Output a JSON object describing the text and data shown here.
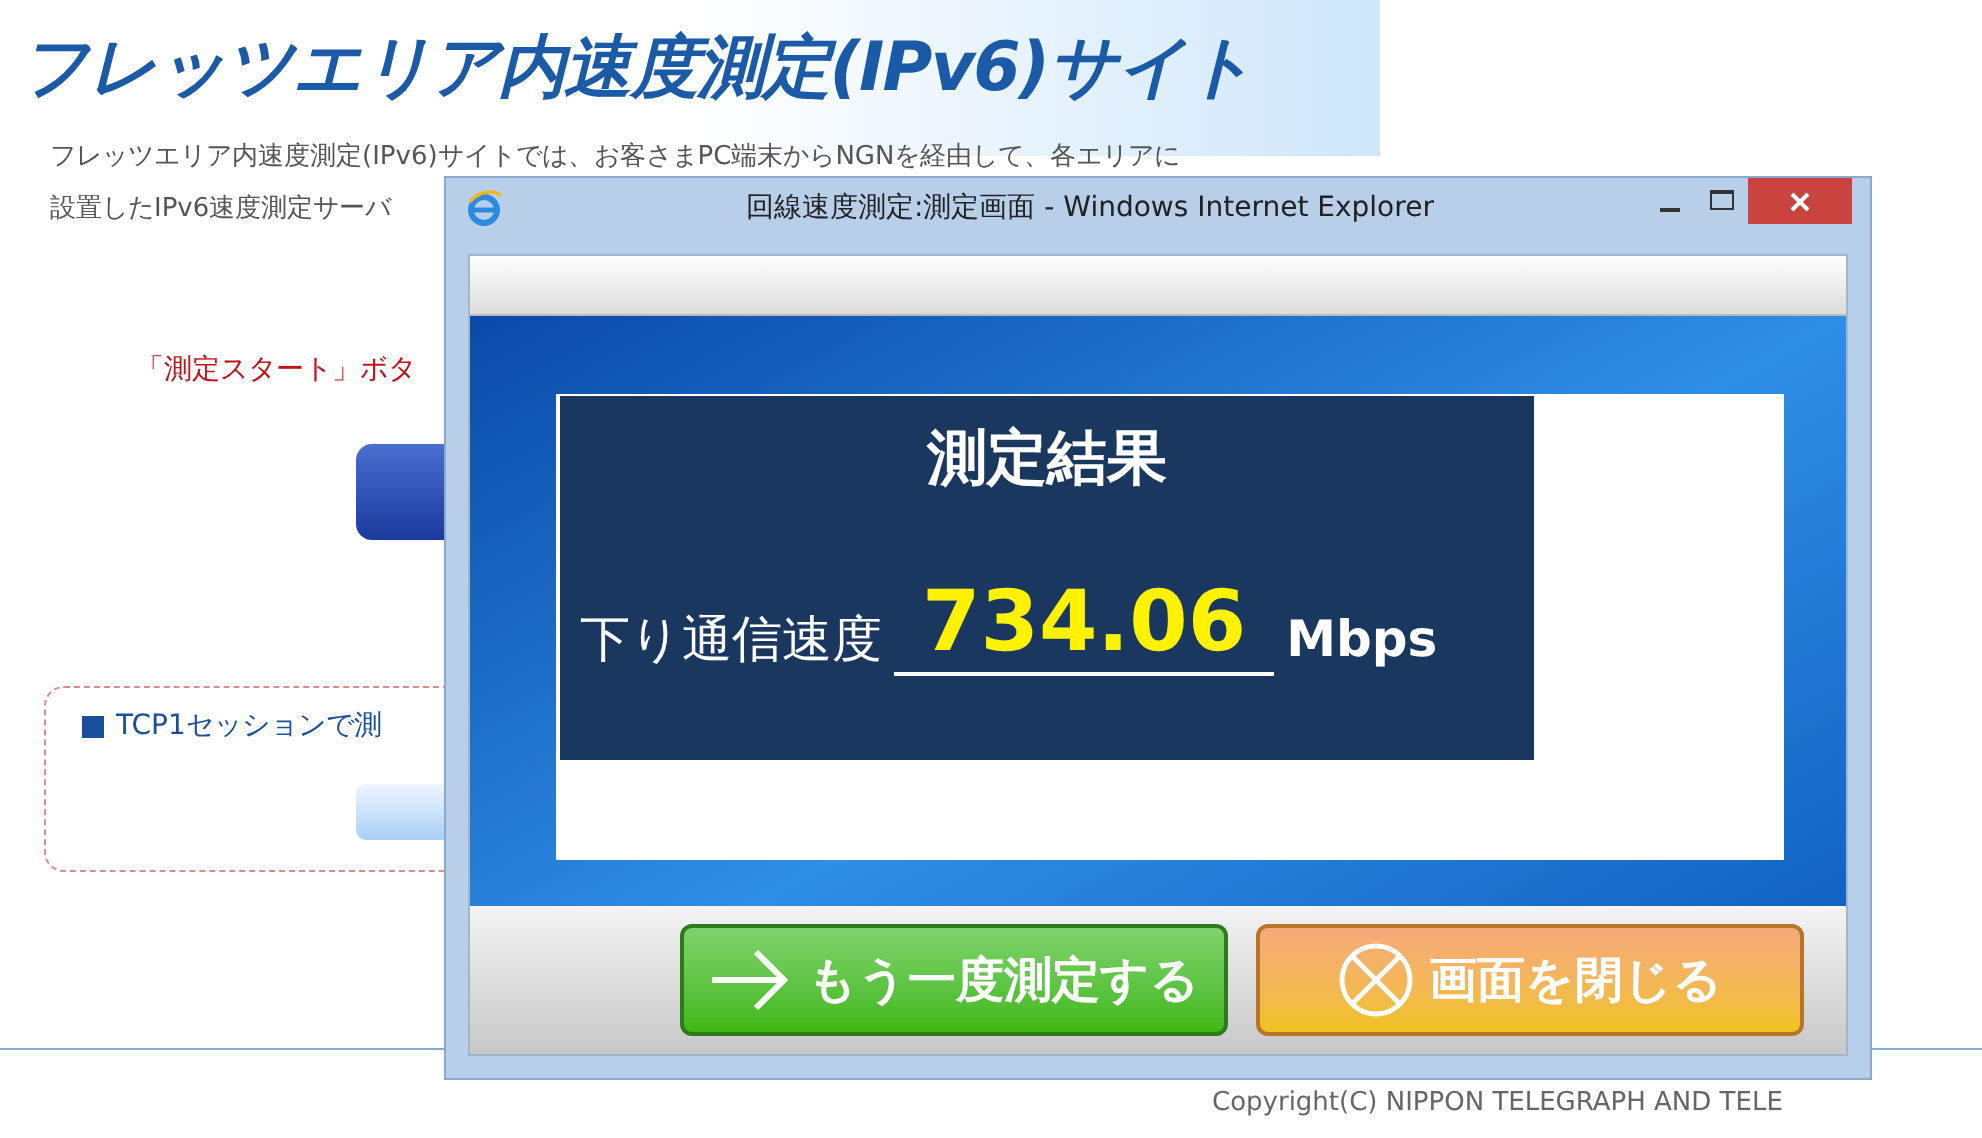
{
  "background_page": {
    "title": "フレッツエリア内速度測定(IPv6)サイト",
    "intro_lines": [
      "フレッツエリア内速度測定(IPv6)サイトでは、お客さまPC端末からNGNを経由して、各エリアに",
      "設置したIPv6速度測定サーバ"
    ],
    "instruction": "「測定スタート」ボタ",
    "tcp_section": {
      "label": "TCP1セッションで測"
    },
    "copyright": "Copyright(C) NIPPON TELEGRAPH AND TELE"
  },
  "window": {
    "title": "回線速度測定:測定画面 - Windows Internet Explorer",
    "result": {
      "heading": "測定結果",
      "label": "下り通信速度",
      "value": "734.06",
      "unit": "Mbps"
    },
    "buttons": [
      {
        "kind": "retry",
        "label": "もう一度測定する"
      },
      {
        "kind": "close",
        "label": "画面を閉じる"
      }
    ]
  }
}
